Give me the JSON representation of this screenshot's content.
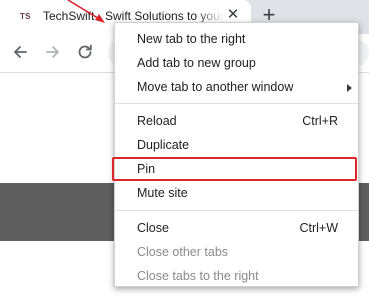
{
  "tab": {
    "favicon_text": "TS",
    "title": "TechSwift - Swift Solutions to your",
    "close_glyph": "✕",
    "new_tab_glyph": "+"
  },
  "colors": {
    "annotation_red": "#d9262b",
    "page_band": "#5f5f5f"
  },
  "icons": {
    "back": "back-arrow-icon",
    "forward": "forward-arrow-icon",
    "reload": "reload-icon"
  },
  "context_menu": {
    "items": [
      {
        "label": "New tab to the right",
        "shortcut": "",
        "enabled": true
      },
      {
        "label": "Add tab to new group",
        "shortcut": "",
        "enabled": true
      },
      {
        "label": "Move tab to another window",
        "shortcut": "",
        "enabled": true,
        "submenu": true
      },
      {
        "label": "Reload",
        "shortcut": "Ctrl+R",
        "enabled": true
      },
      {
        "label": "Duplicate",
        "shortcut": "",
        "enabled": true
      },
      {
        "label": "Pin",
        "shortcut": "",
        "enabled": true,
        "highlighted": true
      },
      {
        "label": "Mute site",
        "shortcut": "",
        "enabled": true
      },
      {
        "label": "Close",
        "shortcut": "Ctrl+W",
        "enabled": true
      },
      {
        "label": "Close other tabs",
        "shortcut": "",
        "enabled": false
      },
      {
        "label": "Close tabs to the right",
        "shortcut": "",
        "enabled": false
      }
    ]
  }
}
